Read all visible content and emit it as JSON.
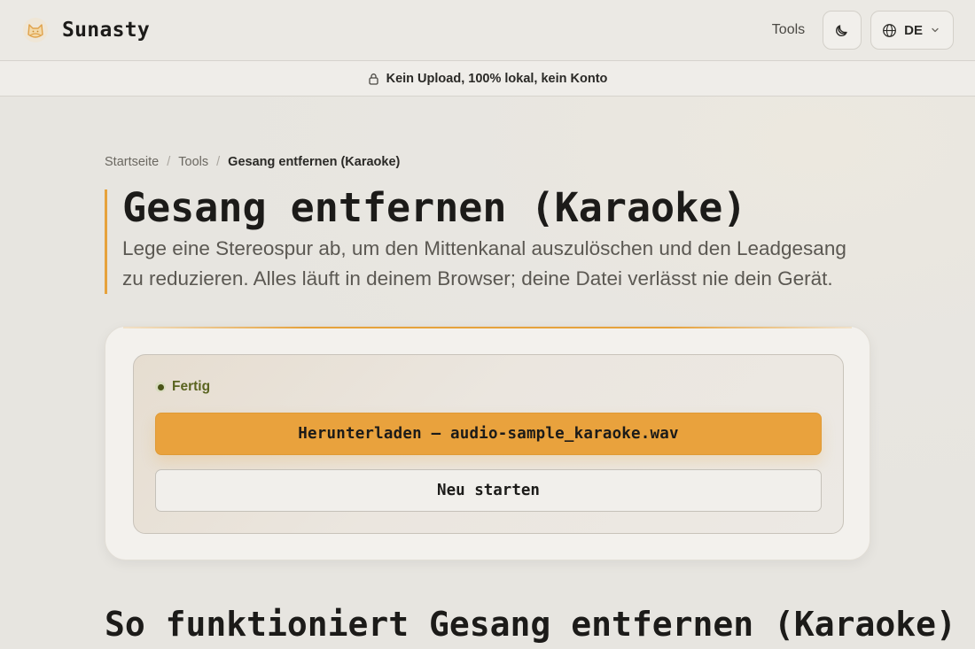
{
  "header": {
    "brand_name": "Sunasty",
    "nav_tools": "Tools",
    "language": "DE"
  },
  "banner": {
    "text": "Kein Upload, 100% lokal, kein Konto"
  },
  "breadcrumb": {
    "home": "Startseite",
    "tools": "Tools",
    "current": "Gesang entfernen (Karaoke)"
  },
  "hero": {
    "title": "Gesang entfernen (Karaoke)",
    "description": "Lege eine Stereospur ab, um den Mittenkanal auszulöschen und den Leadgesang zu reduzieren. Alles läuft in deinem Browser; deine Datei verlässt nie dein Gerät."
  },
  "tool": {
    "status": "Fertig",
    "download_label": "Herunterladen — audio-sample_karaoke.wav",
    "restart_label": "Neu starten"
  },
  "section": {
    "how_it_works_title": "So funktioniert Gesang entfernen (Karaoke)"
  },
  "colors": {
    "accent": "#e9a23d",
    "status_text": "#5a6420",
    "background": "#e9e7e2"
  }
}
